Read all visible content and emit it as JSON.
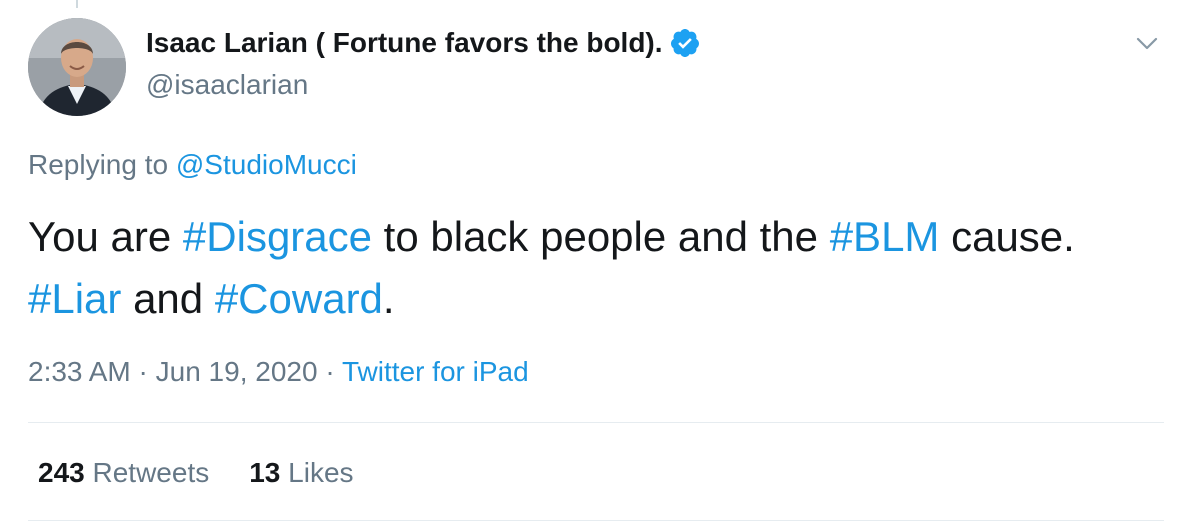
{
  "author": {
    "display_name": "Isaac Larian ( Fortune favors the bold).",
    "handle": "@isaaclarian",
    "verified": true
  },
  "reply": {
    "prefix": "Replying to ",
    "to": "@StudioMucci"
  },
  "tweet": {
    "t1": "You are ",
    "h1": "#Disgrace",
    "t2": " to black people and the ",
    "h2": "#BLM",
    "t3": " cause. ",
    "h3": "#Liar",
    "t4": " and ",
    "h4": "#Coward",
    "t5": "."
  },
  "meta": {
    "time": "2:33 AM",
    "sep1": " · ",
    "date": "Jun 19, 2020",
    "sep2": " · ",
    "source": "Twitter for iPad"
  },
  "stats": {
    "retweets_count": "243",
    "retweets_label": "Retweets",
    "likes_count": "13",
    "likes_label": "Likes"
  },
  "icons": {
    "verified": "verified-badge-icon",
    "more": "chevron-down-icon"
  },
  "colors": {
    "link": "#1b95e0",
    "secondary": "#657786",
    "primary": "#14171a",
    "divider": "#e6ecf0"
  }
}
